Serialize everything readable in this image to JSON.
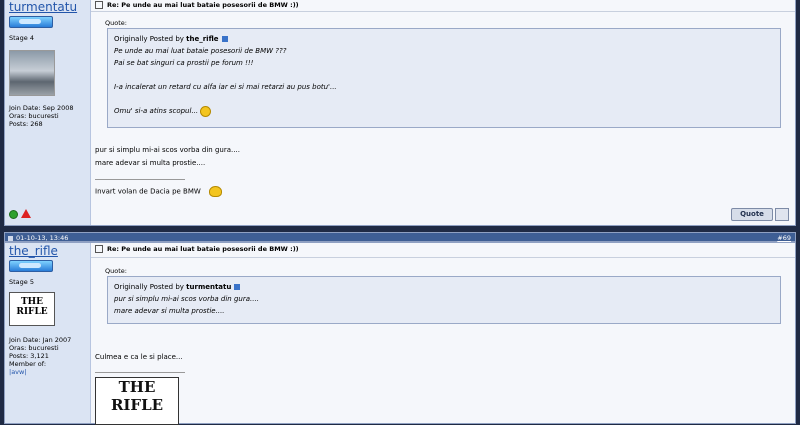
{
  "post1": {
    "title": "Re: Pe unde au mai luat bataie posesorii de BMW :))",
    "user": {
      "name": "turmentatu",
      "rank": "Stage 4",
      "join_date": "Join Date: Sep 2008",
      "location": "Oras: bucuresti",
      "posts": "Posts: 268"
    },
    "quote_label": "Quote:",
    "quote": {
      "originally_posted_by": "Originally Posted by",
      "author": "the_rifle",
      "lines": [
        "Pe unde au mai luat bataie posesorii de BMW ???",
        "Pai se bat singuri ca prostii pe forum !!!",
        "",
        "I-a incalerat un retard cu alfa iar ei si mai retarzi au pus botu'...",
        "",
        "Omu' si-a atins scopul..."
      ]
    },
    "message": [
      "pur si simplu mi-ai scos vorba din gura....",
      "mare adevar si multa prostie...."
    ],
    "signature": "Invart volan de Dacia pe BMW",
    "buttons": {
      "quote": "Quote"
    }
  },
  "post2": {
    "header_time": "01-10-13, 13:46",
    "post_number": "#69",
    "title": "Re: Pe unde au mai luat bataie posesorii de BMW :))",
    "user": {
      "name": "the_rifle",
      "rank": "Stage 5",
      "join_date": "Join Date: Jan 2007",
      "location": "Oras: bucuresti",
      "posts": "Posts: 3,121",
      "member_of": "Member of:",
      "group": "|avw|"
    },
    "quote_label": "Quote:",
    "quote": {
      "originally_posted_by": "Originally Posted by",
      "author": "turmentatu",
      "lines": [
        "pur si simplu mi-ai scos vorba din gura....",
        "mare adevar si multa prostie...."
      ]
    },
    "message": [
      "Culmea e ca le si place..."
    ],
    "signature_image_text": "THE RIFLE"
  },
  "colors": {
    "link": "#2255aa",
    "header_bar": "#3e5e94",
    "quote_bg": "#e6ebf5",
    "user_panel": "#dbe4f3"
  }
}
